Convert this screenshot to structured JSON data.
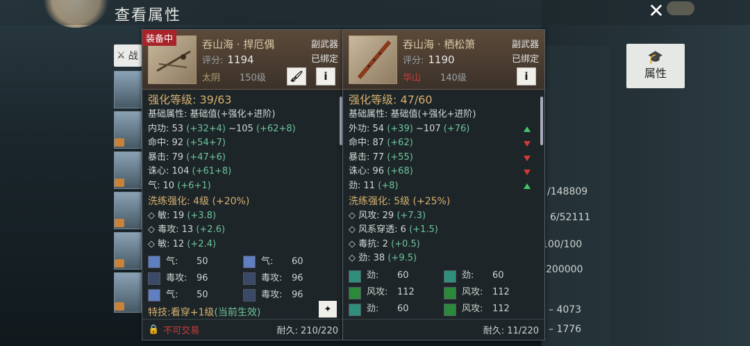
{
  "header": {
    "title": "查看属性"
  },
  "side_tab_label": "战",
  "attr_button": {
    "label": "属性"
  },
  "background_stats": [
    {
      "text": "/148809"
    },
    {
      "text": "6/52111"
    },
    {
      "text": "100/100"
    },
    {
      "text": "200000"
    },
    {
      "text": "– 4073"
    },
    {
      "text": "– 1776"
    }
  ],
  "left_item": {
    "badge": "装备中",
    "name": "吞山海 · 捍厄偶",
    "slot": "副武器",
    "bound": "已绑定",
    "score_label": "评分:",
    "score": "1194",
    "sect": "太阴",
    "sect_color": "#b0a070",
    "level": "150级",
    "enhance": "强化等级: 39/63",
    "base_header": "基础属性: 基础值(+强化+进阶)",
    "base_stats": [
      {
        "name": "内功:",
        "base": "53",
        "bonus": "(+32+4)",
        "extra": "~105",
        "extra_bonus": "(+62+8)"
      },
      {
        "name": "命中:",
        "base": "92",
        "bonus": "(+54+7)",
        "extra": "",
        "extra_bonus": ""
      },
      {
        "name": "暴击:",
        "base": "79",
        "bonus": "(+47+6)",
        "extra": "",
        "extra_bonus": ""
      },
      {
        "name": "诛心:",
        "base": "104",
        "bonus": "(+61+8)",
        "extra": "",
        "extra_bonus": ""
      },
      {
        "name": "气:",
        "base": "10",
        "bonus": "(+6+1)",
        "extra": "",
        "extra_bonus": ""
      }
    ],
    "wash": "洗练强化: 4级 (+20%)",
    "wash_stats": [
      {
        "name": "◇ 敏:",
        "base": "19",
        "bonus": "(+3.8)"
      },
      {
        "name": "◇ 毒攻:",
        "base": "13",
        "bonus": "(+2.6)"
      },
      {
        "name": "◇ 敏:",
        "base": "12",
        "bonus": "(+2.4)"
      }
    ],
    "gems": [
      {
        "name": "气:",
        "value": "50",
        "color": "#5f7fc0"
      },
      {
        "name": "气:",
        "value": "60",
        "color": "#5f7fc0"
      },
      {
        "name": "毒攻:",
        "value": "96",
        "color": "#3a4a66"
      },
      {
        "name": "毒攻:",
        "value": "96",
        "color": "#3a4a66"
      },
      {
        "name": "气:",
        "value": "50",
        "color": "#5f7fc0"
      },
      {
        "name": "毒攻:",
        "value": "96",
        "color": "#3a4a66"
      }
    ],
    "special_label": "特技:看穿+1级",
    "special_active": "(当前生效)",
    "lock_label": "不可交易",
    "durability": "耐久: 210/220"
  },
  "right_item": {
    "name": "吞山海 · 栖松箫",
    "slot": "副武器",
    "bound": "已绑定",
    "score_label": "评分:",
    "score": "1190",
    "sect": "华山",
    "sect_color": "#d23a3a",
    "level": "140级",
    "enhance": "强化等级: 47/60",
    "base_header": "基础属性: 基础值(+强化+进阶)",
    "base_stats": [
      {
        "name": "外功:",
        "base": "54",
        "bonus": "(+39)",
        "extra": "~107",
        "extra_bonus": "(+76)",
        "trend": "up"
      },
      {
        "name": "命中:",
        "base": "87",
        "bonus": "(+62)",
        "extra": "",
        "extra_bonus": "",
        "trend": "down"
      },
      {
        "name": "暴击:",
        "base": "77",
        "bonus": "(+55)",
        "extra": "",
        "extra_bonus": "",
        "trend": "down"
      },
      {
        "name": "诛心:",
        "base": "96",
        "bonus": "(+68)",
        "extra": "",
        "extra_bonus": "",
        "trend": "down"
      },
      {
        "name": "劲:",
        "base": "11",
        "bonus": "(+8)",
        "extra": "",
        "extra_bonus": "",
        "trend": "up"
      }
    ],
    "wash": "洗练强化: 5级 (+25%)",
    "wash_stats": [
      {
        "name": "◇ 风攻:",
        "base": "29",
        "bonus": "(+7.3)"
      },
      {
        "name": "◇ 风系穿透:",
        "base": "6",
        "bonus": "(+1.5)"
      },
      {
        "name": "◇ 毒抗:",
        "base": "2",
        "bonus": "(+0.5)"
      },
      {
        "name": "◇ 劲:",
        "base": "38",
        "bonus": "(+9.5)"
      }
    ],
    "gems": [
      {
        "name": "劲:",
        "value": "60",
        "color": "#2f8f7a"
      },
      {
        "name": "劲:",
        "value": "60",
        "color": "#2f8f7a"
      },
      {
        "name": "风攻:",
        "value": "112",
        "color": "#2a8a3a"
      },
      {
        "name": "风攻:",
        "value": "112",
        "color": "#2a8a3a"
      },
      {
        "name": "劲:",
        "value": "60",
        "color": "#2f8f7a"
      },
      {
        "name": "风攻:",
        "value": "112",
        "color": "#2a8a3a"
      }
    ],
    "durability": "耐久: 11/220"
  }
}
